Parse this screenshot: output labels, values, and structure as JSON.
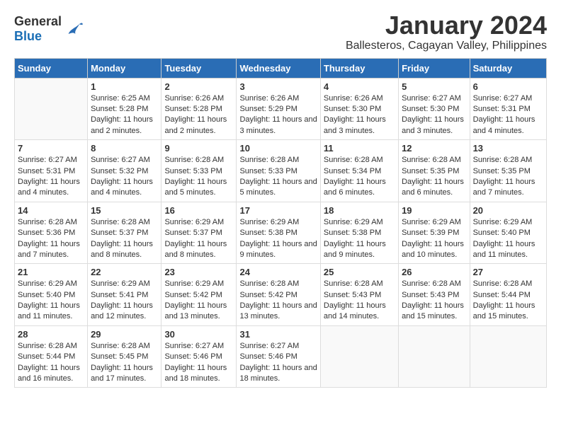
{
  "logo": {
    "general": "General",
    "blue": "Blue"
  },
  "title": "January 2024",
  "subtitle": "Ballesteros, Cagayan Valley, Philippines",
  "days_of_week": [
    "Sunday",
    "Monday",
    "Tuesday",
    "Wednesday",
    "Thursday",
    "Friday",
    "Saturday"
  ],
  "weeks": [
    [
      {
        "day": "",
        "sunrise": "",
        "sunset": "",
        "daylight": ""
      },
      {
        "day": "1",
        "sunrise": "Sunrise: 6:25 AM",
        "sunset": "Sunset: 5:28 PM",
        "daylight": "Daylight: 11 hours and 2 minutes."
      },
      {
        "day": "2",
        "sunrise": "Sunrise: 6:26 AM",
        "sunset": "Sunset: 5:28 PM",
        "daylight": "Daylight: 11 hours and 2 minutes."
      },
      {
        "day": "3",
        "sunrise": "Sunrise: 6:26 AM",
        "sunset": "Sunset: 5:29 PM",
        "daylight": "Daylight: 11 hours and 3 minutes."
      },
      {
        "day": "4",
        "sunrise": "Sunrise: 6:26 AM",
        "sunset": "Sunset: 5:30 PM",
        "daylight": "Daylight: 11 hours and 3 minutes."
      },
      {
        "day": "5",
        "sunrise": "Sunrise: 6:27 AM",
        "sunset": "Sunset: 5:30 PM",
        "daylight": "Daylight: 11 hours and 3 minutes."
      },
      {
        "day": "6",
        "sunrise": "Sunrise: 6:27 AM",
        "sunset": "Sunset: 5:31 PM",
        "daylight": "Daylight: 11 hours and 4 minutes."
      }
    ],
    [
      {
        "day": "7",
        "sunrise": "Sunrise: 6:27 AM",
        "sunset": "Sunset: 5:31 PM",
        "daylight": "Daylight: 11 hours and 4 minutes."
      },
      {
        "day": "8",
        "sunrise": "Sunrise: 6:27 AM",
        "sunset": "Sunset: 5:32 PM",
        "daylight": "Daylight: 11 hours and 4 minutes."
      },
      {
        "day": "9",
        "sunrise": "Sunrise: 6:28 AM",
        "sunset": "Sunset: 5:33 PM",
        "daylight": "Daylight: 11 hours and 5 minutes."
      },
      {
        "day": "10",
        "sunrise": "Sunrise: 6:28 AM",
        "sunset": "Sunset: 5:33 PM",
        "daylight": "Daylight: 11 hours and 5 minutes."
      },
      {
        "day": "11",
        "sunrise": "Sunrise: 6:28 AM",
        "sunset": "Sunset: 5:34 PM",
        "daylight": "Daylight: 11 hours and 6 minutes."
      },
      {
        "day": "12",
        "sunrise": "Sunrise: 6:28 AM",
        "sunset": "Sunset: 5:35 PM",
        "daylight": "Daylight: 11 hours and 6 minutes."
      },
      {
        "day": "13",
        "sunrise": "Sunrise: 6:28 AM",
        "sunset": "Sunset: 5:35 PM",
        "daylight": "Daylight: 11 hours and 7 minutes."
      }
    ],
    [
      {
        "day": "14",
        "sunrise": "Sunrise: 6:28 AM",
        "sunset": "Sunset: 5:36 PM",
        "daylight": "Daylight: 11 hours and 7 minutes."
      },
      {
        "day": "15",
        "sunrise": "Sunrise: 6:28 AM",
        "sunset": "Sunset: 5:37 PM",
        "daylight": "Daylight: 11 hours and 8 minutes."
      },
      {
        "day": "16",
        "sunrise": "Sunrise: 6:29 AM",
        "sunset": "Sunset: 5:37 PM",
        "daylight": "Daylight: 11 hours and 8 minutes."
      },
      {
        "day": "17",
        "sunrise": "Sunrise: 6:29 AM",
        "sunset": "Sunset: 5:38 PM",
        "daylight": "Daylight: 11 hours and 9 minutes."
      },
      {
        "day": "18",
        "sunrise": "Sunrise: 6:29 AM",
        "sunset": "Sunset: 5:38 PM",
        "daylight": "Daylight: 11 hours and 9 minutes."
      },
      {
        "day": "19",
        "sunrise": "Sunrise: 6:29 AM",
        "sunset": "Sunset: 5:39 PM",
        "daylight": "Daylight: 11 hours and 10 minutes."
      },
      {
        "day": "20",
        "sunrise": "Sunrise: 6:29 AM",
        "sunset": "Sunset: 5:40 PM",
        "daylight": "Daylight: 11 hours and 11 minutes."
      }
    ],
    [
      {
        "day": "21",
        "sunrise": "Sunrise: 6:29 AM",
        "sunset": "Sunset: 5:40 PM",
        "daylight": "Daylight: 11 hours and 11 minutes."
      },
      {
        "day": "22",
        "sunrise": "Sunrise: 6:29 AM",
        "sunset": "Sunset: 5:41 PM",
        "daylight": "Daylight: 11 hours and 12 minutes."
      },
      {
        "day": "23",
        "sunrise": "Sunrise: 6:29 AM",
        "sunset": "Sunset: 5:42 PM",
        "daylight": "Daylight: 11 hours and 13 minutes."
      },
      {
        "day": "24",
        "sunrise": "Sunrise: 6:28 AM",
        "sunset": "Sunset: 5:42 PM",
        "daylight": "Daylight: 11 hours and 13 minutes."
      },
      {
        "day": "25",
        "sunrise": "Sunrise: 6:28 AM",
        "sunset": "Sunset: 5:43 PM",
        "daylight": "Daylight: 11 hours and 14 minutes."
      },
      {
        "day": "26",
        "sunrise": "Sunrise: 6:28 AM",
        "sunset": "Sunset: 5:43 PM",
        "daylight": "Daylight: 11 hours and 15 minutes."
      },
      {
        "day": "27",
        "sunrise": "Sunrise: 6:28 AM",
        "sunset": "Sunset: 5:44 PM",
        "daylight": "Daylight: 11 hours and 15 minutes."
      }
    ],
    [
      {
        "day": "28",
        "sunrise": "Sunrise: 6:28 AM",
        "sunset": "Sunset: 5:44 PM",
        "daylight": "Daylight: 11 hours and 16 minutes."
      },
      {
        "day": "29",
        "sunrise": "Sunrise: 6:28 AM",
        "sunset": "Sunset: 5:45 PM",
        "daylight": "Daylight: 11 hours and 17 minutes."
      },
      {
        "day": "30",
        "sunrise": "Sunrise: 6:27 AM",
        "sunset": "Sunset: 5:46 PM",
        "daylight": "Daylight: 11 hours and 18 minutes."
      },
      {
        "day": "31",
        "sunrise": "Sunrise: 6:27 AM",
        "sunset": "Sunset: 5:46 PM",
        "daylight": "Daylight: 11 hours and 18 minutes."
      },
      {
        "day": "",
        "sunrise": "",
        "sunset": "",
        "daylight": ""
      },
      {
        "day": "",
        "sunrise": "",
        "sunset": "",
        "daylight": ""
      },
      {
        "day": "",
        "sunrise": "",
        "sunset": "",
        "daylight": ""
      }
    ]
  ]
}
